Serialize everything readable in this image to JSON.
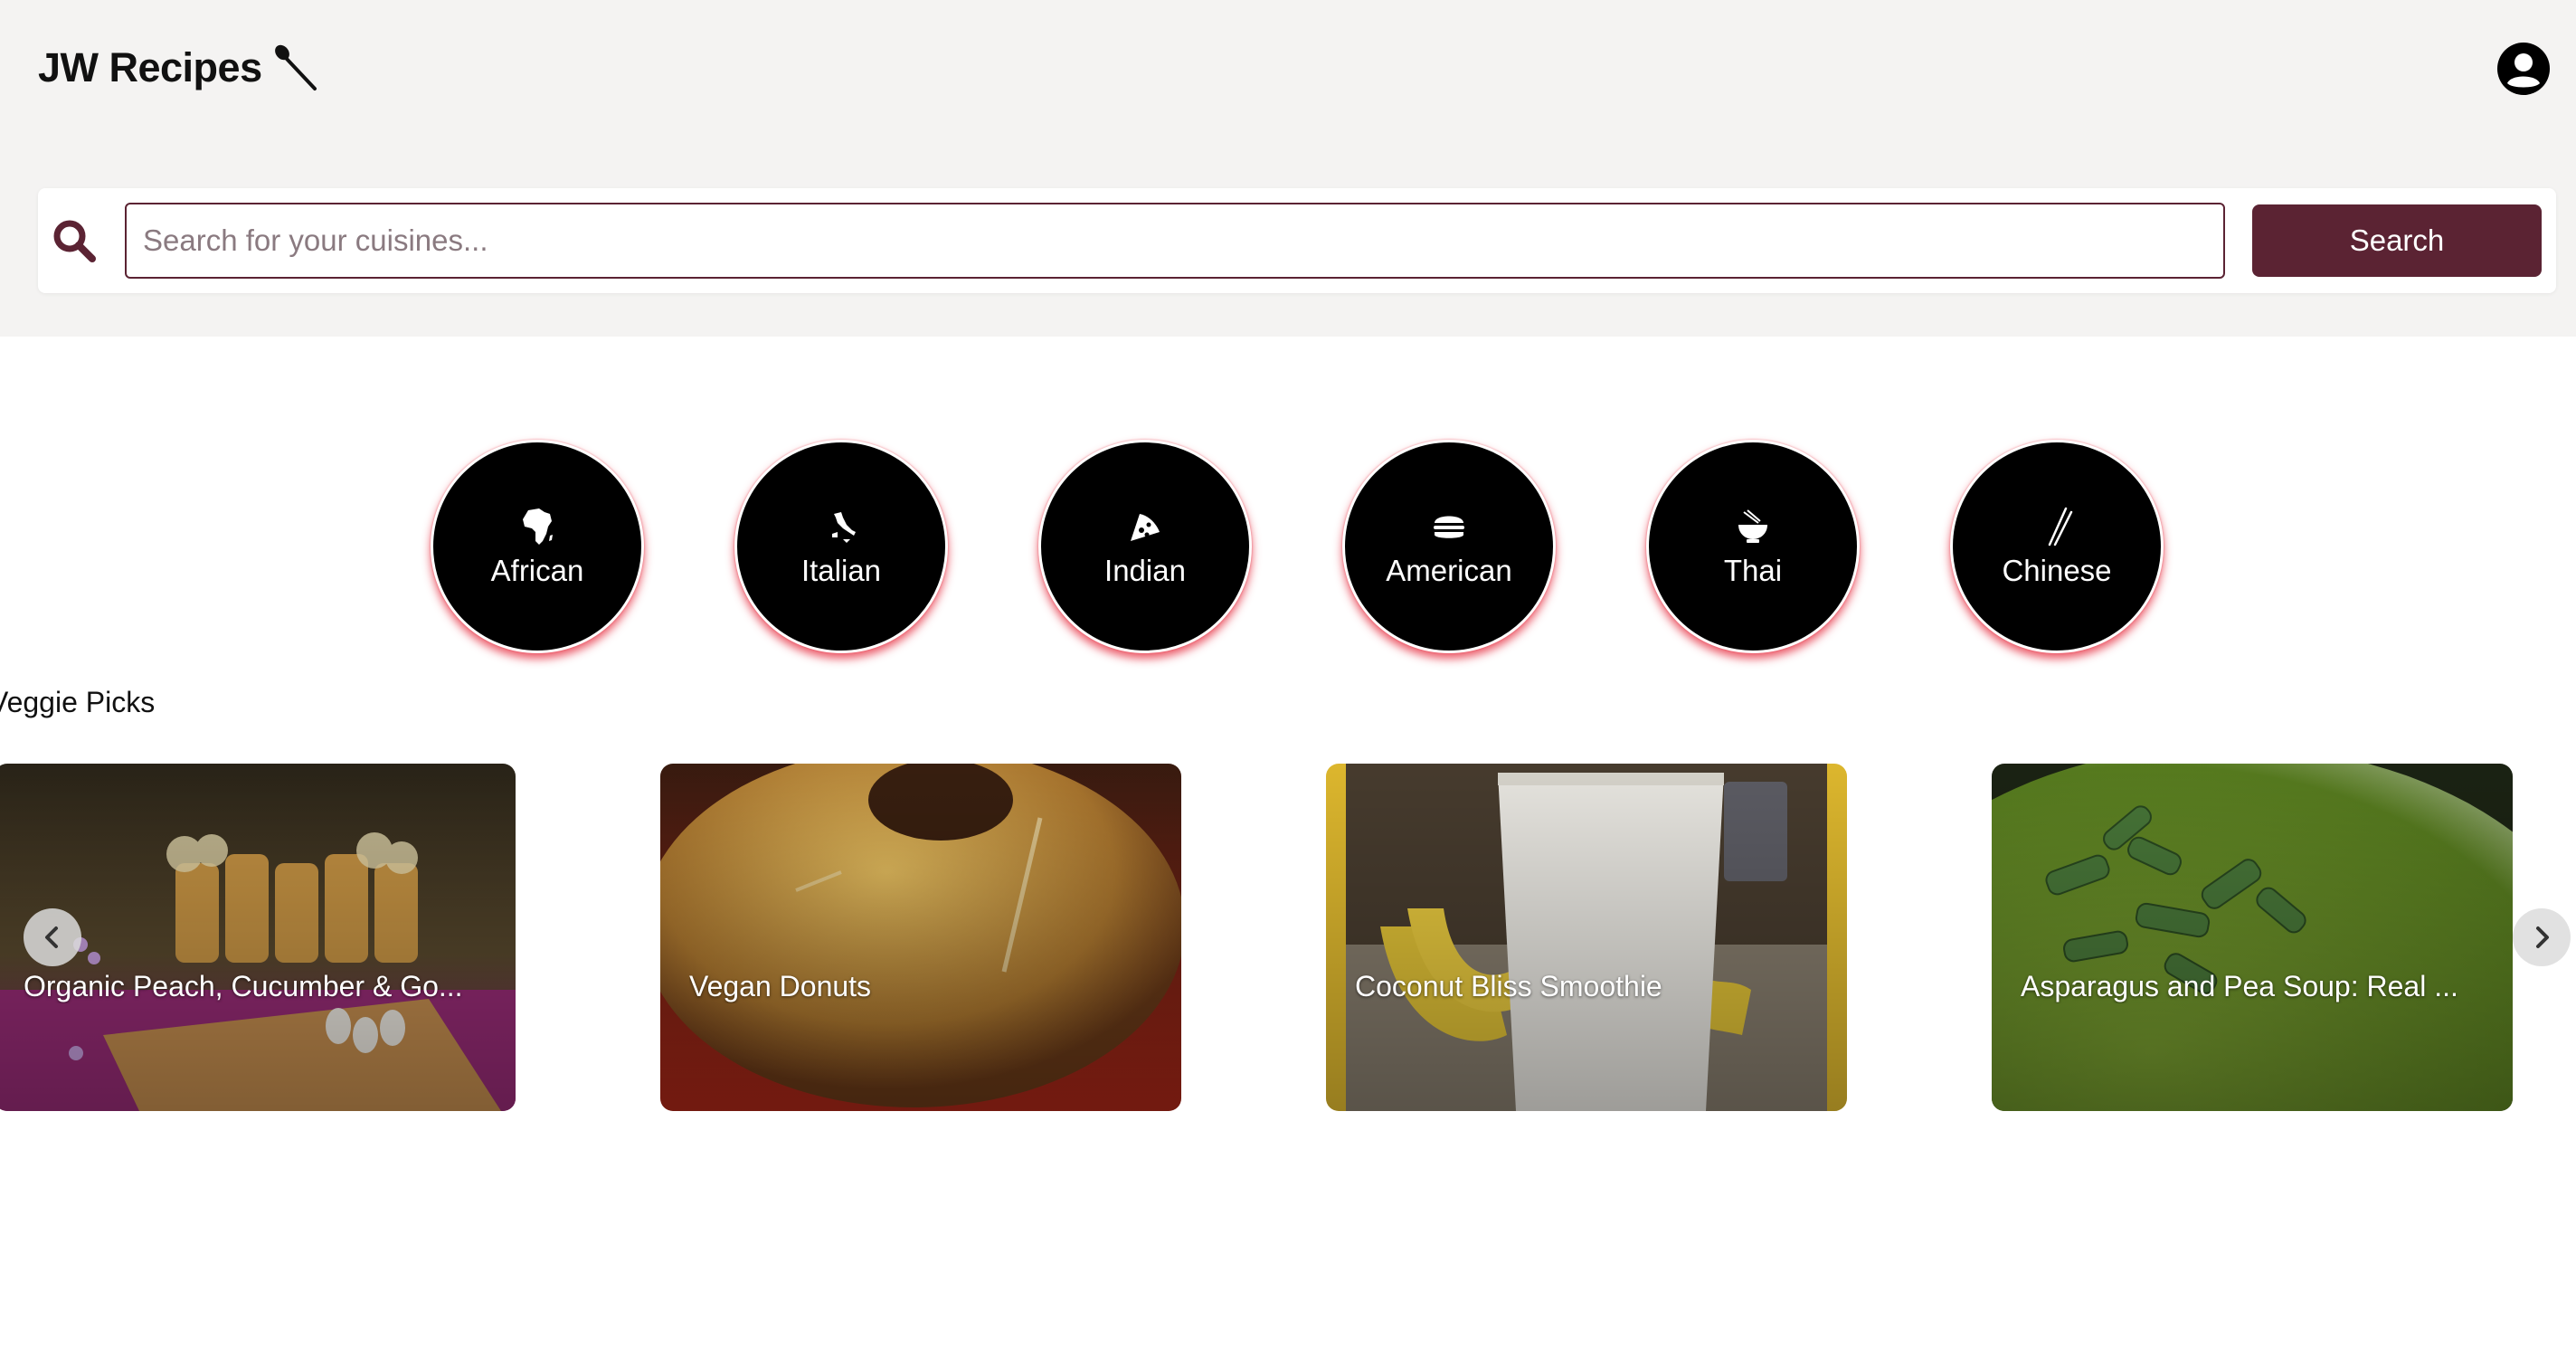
{
  "header": {
    "brand_title": "JW Recipes",
    "brand_icon": "spoon-icon",
    "profile_icon": "user-circle-icon"
  },
  "search": {
    "icon": "magnifier-icon",
    "placeholder": "Search for your cuisines...",
    "value": "",
    "button_label": "Search"
  },
  "categories": [
    {
      "label": "African",
      "icon": "africa-map-icon"
    },
    {
      "label": "Italian",
      "icon": "italy-map-icon"
    },
    {
      "label": "Indian",
      "icon": "pizza-slice-icon"
    },
    {
      "label": "American",
      "icon": "burger-icon"
    },
    {
      "label": "Thai",
      "icon": "noodle-bowl-icon"
    },
    {
      "label": "Chinese",
      "icon": "chopsticks-icon"
    }
  ],
  "veggie_picks": {
    "title": "Veggie Picks",
    "items": [
      {
        "title": "Organic Peach, Cucumber & Go..."
      },
      {
        "title": "Vegan Donuts"
      },
      {
        "title": "Coconut Bliss Smoothie"
      },
      {
        "title": "Asparagus and Pea Soup: Real ..."
      }
    ],
    "prev_icon": "chevron-left-icon",
    "next_icon": "chevron-right-icon"
  },
  "colors": {
    "accent": "#5b2333",
    "header_bg": "#f4f3f2",
    "category_glow": "#e84050"
  }
}
